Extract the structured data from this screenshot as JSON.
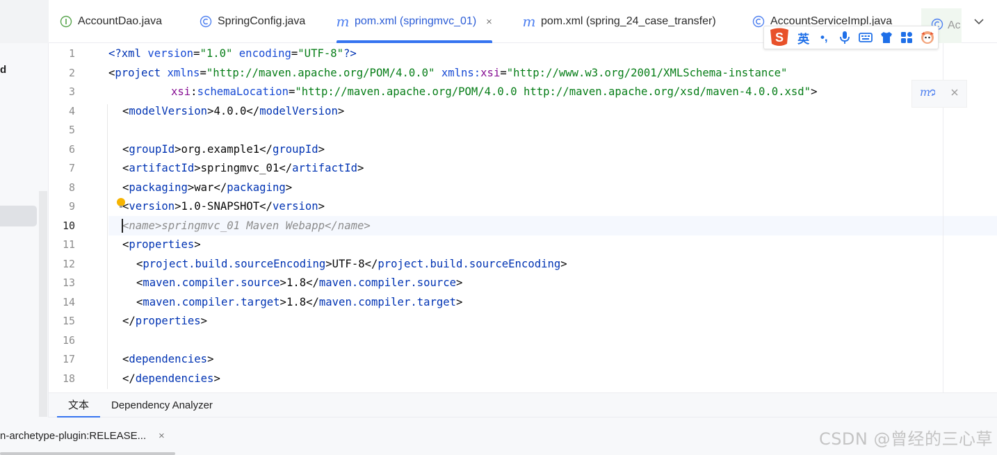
{
  "tabs": [
    {
      "label": "AccountDao.java",
      "icon": "interface-icon",
      "active": false
    },
    {
      "label": "SpringConfig.java",
      "icon": "class-icon",
      "active": false
    },
    {
      "label": "pom.xml (springmvc_01)",
      "icon": "maven-icon",
      "active": true,
      "close": "×"
    },
    {
      "label": "pom.xml (spring_24_case_transfer)",
      "icon": "maven-icon",
      "active": false
    },
    {
      "label": "AccountServiceImpl.java",
      "icon": "class-icon",
      "active": false
    },
    {
      "label": "Ac",
      "icon": "class-icon",
      "active": false
    }
  ],
  "ime": {
    "lang": "英",
    "punct": "•,",
    "logo": "S"
  },
  "editor": {
    "current_line": 10,
    "lines": [
      "1",
      "2",
      "3",
      "4",
      "5",
      "6",
      "7",
      "8",
      "9",
      "10",
      "11",
      "12",
      "13",
      "14",
      "15",
      "16",
      "17",
      "18"
    ],
    "code": {
      "l1_decl": "<?",
      "l1_xml": "xml",
      "l1_version_attr": "version",
      "l1_version_val": "\"1.0\"",
      "l1_encoding_attr": "encoding",
      "l1_encoding_val": "\"UTF-8\"",
      "l1_end": "?>",
      "l2_tag": "project",
      "l2_xmlns_attr": "xmlns",
      "l2_xmlns_val": "\"http://maven.apache.org/POM/4.0.0\"",
      "l2_xsi_ns": "xmlns:",
      "l2_xsi_attr": "xsi",
      "l2_xsi_val": "\"http://www.w3.org/2001/XMLSchema-instance\"",
      "l3_xsi_ns": "xsi",
      "l3_attr": "schemaLocation",
      "l3_val": "\"http://maven.apache.org/POM/4.0.0 http://maven.apache.org/xsd/maven-4.0.0.xsd\"",
      "modelVersion_tag": "modelVersion",
      "modelVersion_val": "4.0.0",
      "groupId_tag": "groupId",
      "groupId_val": "org.example1",
      "artifactId_tag": "artifactId",
      "artifactId_val": "springmvc_01",
      "packaging_tag": "packaging",
      "packaging_val": "war",
      "version_tag": "version",
      "version_val": "1.0-SNAPSHOT",
      "name_line": "<name>springmvc_01 Maven Webapp</name>",
      "properties_tag": "properties",
      "enc_tag": "project.build.sourceEncoding",
      "enc_val": "UTF-8",
      "src_tag": "maven.compiler.source",
      "src_val": "1.8",
      "tgt_tag": "maven.compiler.target",
      "tgt_val": "1.8",
      "deps_tag": "dependencies"
    }
  },
  "sidebar": {
    "fragment": "d"
  },
  "bottom_tabs": [
    {
      "label": "文本",
      "active": true
    },
    {
      "label": "Dependency Analyzer",
      "active": false
    }
  ],
  "run_tab": {
    "label": "n-archetype-plugin:RELEASE...",
    "close": "×"
  },
  "watermark": "CSDN @曾经的三心草",
  "colors": {
    "accent": "#3574f0",
    "tag": "#0033b3",
    "value": "#067d17",
    "namespace": "#871094"
  }
}
